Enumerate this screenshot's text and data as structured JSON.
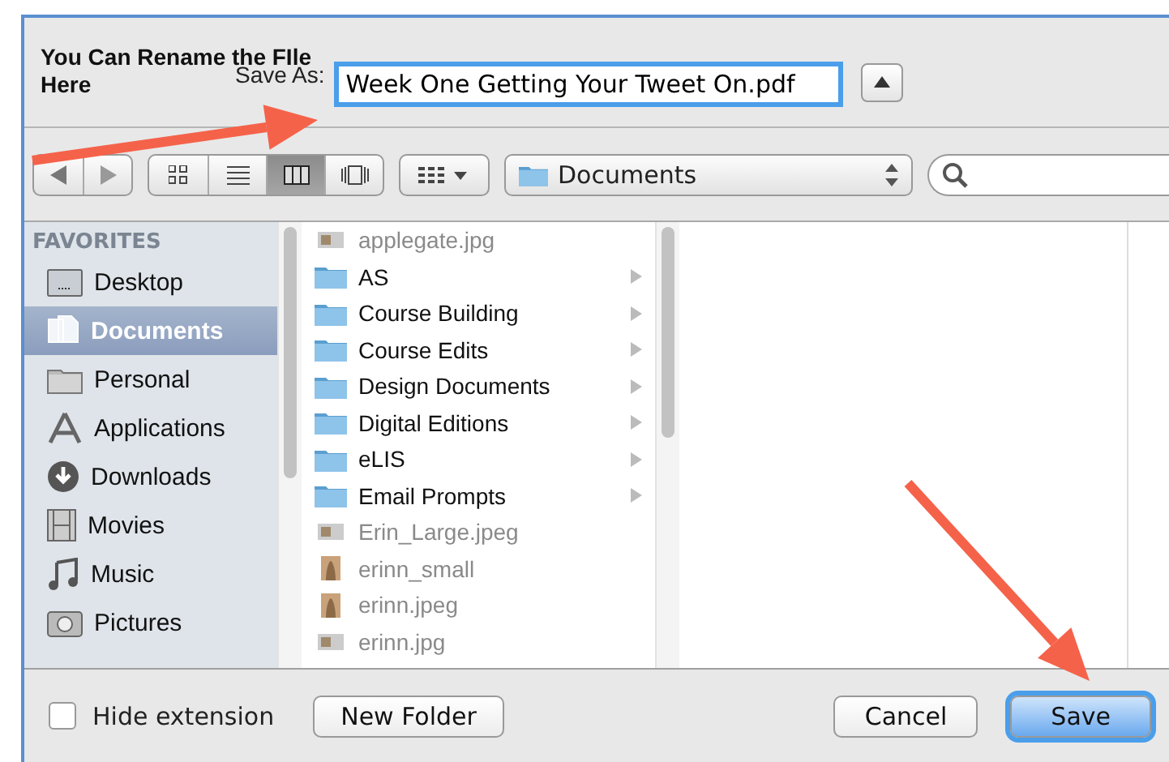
{
  "annotation": {
    "lines": [
      "You Can Rename the FIle",
      "Here"
    ]
  },
  "save_as": {
    "label": "Save As:",
    "value": "Week One Getting Your Tweet On.pdf",
    "focused": true
  },
  "toolbar": {
    "views": [
      {
        "kind": "icons",
        "selected": false
      },
      {
        "kind": "list",
        "selected": false
      },
      {
        "kind": "columns",
        "selected": true
      },
      {
        "kind": "coverflow",
        "selected": false
      }
    ],
    "location": "Documents"
  },
  "sidebar": {
    "heading": "FAVORITES",
    "items": [
      {
        "label": "Desktop",
        "kind": "desktop",
        "selected": false
      },
      {
        "label": "Documents",
        "kind": "documents",
        "selected": true
      },
      {
        "label": "Personal",
        "kind": "folder",
        "selected": false
      },
      {
        "label": "Applications",
        "kind": "apps",
        "selected": false
      },
      {
        "label": "Downloads",
        "kind": "downloads",
        "selected": false
      },
      {
        "label": "Movies",
        "kind": "movies",
        "selected": false
      },
      {
        "label": "Music",
        "kind": "music",
        "selected": false
      },
      {
        "label": "Pictures",
        "kind": "pictures",
        "selected": false
      }
    ]
  },
  "files": [
    {
      "name": "applegate.jpg",
      "kind": "image",
      "disabled": true
    },
    {
      "name": "AS",
      "kind": "folder",
      "disabled": false
    },
    {
      "name": "Course Building",
      "kind": "folder",
      "disabled": false
    },
    {
      "name": "Course Edits",
      "kind": "folder",
      "disabled": false
    },
    {
      "name": "Design Documents",
      "kind": "folder",
      "disabled": false
    },
    {
      "name": "Digital Editions",
      "kind": "folder",
      "disabled": false
    },
    {
      "name": "eLIS",
      "kind": "folder",
      "disabled": false
    },
    {
      "name": "Email Prompts",
      "kind": "folder",
      "disabled": false
    },
    {
      "name": "Erin_Large.jpeg",
      "kind": "image",
      "disabled": true
    },
    {
      "name": "erinn_small",
      "kind": "photo",
      "disabled": true
    },
    {
      "name": "erinn.jpeg",
      "kind": "photo",
      "disabled": true
    },
    {
      "name": "erinn.jpg",
      "kind": "image",
      "disabled": true
    }
  ],
  "bottom": {
    "hide_extension": {
      "label": "Hide extension",
      "checked": false
    },
    "new_folder": "New Folder",
    "cancel": "Cancel",
    "save": "Save"
  }
}
